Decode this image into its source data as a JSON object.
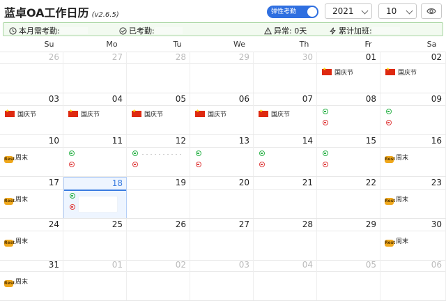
{
  "app": {
    "title": "蓝卓OA工作日历",
    "version": "(v2.6.5)"
  },
  "controls": {
    "flex_toggle_label": "弹性考勤",
    "year": "2021",
    "month": "10"
  },
  "summary": {
    "monthly_required": "本月需考勤:",
    "attended": "已考勤:",
    "abnormal": "异常: 0天",
    "overtime": "累计加班:"
  },
  "weekdays": [
    "Su",
    "Mo",
    "Tu",
    "We",
    "Th",
    "Fr",
    "Sa"
  ],
  "labels": {
    "holiday": "国庆节",
    "weekend": "周末",
    "weekend_icon_text": "Rest"
  },
  "weeks": [
    {
      "days": [
        {
          "n": "26",
          "m": "other"
        },
        {
          "n": "27",
          "m": "other"
        },
        {
          "n": "28",
          "m": "other"
        },
        {
          "n": "29",
          "m": "other"
        },
        {
          "n": "30",
          "m": "other"
        },
        {
          "n": "01",
          "m": "cur",
          "e": "holiday"
        },
        {
          "n": "02",
          "m": "cur",
          "e": "holiday"
        }
      ]
    },
    {
      "days": [
        {
          "n": "03",
          "m": "cur",
          "e": "holiday"
        },
        {
          "n": "04",
          "m": "cur",
          "e": "holiday"
        },
        {
          "n": "05",
          "m": "cur",
          "e": "holiday"
        },
        {
          "n": "06",
          "m": "cur",
          "e": "holiday"
        },
        {
          "n": "07",
          "m": "cur",
          "e": "holiday"
        },
        {
          "n": "08",
          "m": "cur",
          "e": "attend"
        },
        {
          "n": "09",
          "m": "cur",
          "e": "attend"
        }
      ]
    },
    {
      "days": [
        {
          "n": "10",
          "m": "cur",
          "e": "weekend"
        },
        {
          "n": "11",
          "m": "cur",
          "e": "attend"
        },
        {
          "n": "12",
          "m": "cur",
          "e": "attend"
        },
        {
          "n": "13",
          "m": "cur",
          "e": "attend"
        },
        {
          "n": "14",
          "m": "cur",
          "e": "attend"
        },
        {
          "n": "15",
          "m": "cur",
          "e": "attend"
        },
        {
          "n": "16",
          "m": "cur",
          "e": "weekend"
        }
      ]
    },
    {
      "days": [
        {
          "n": "17",
          "m": "cur",
          "e": "weekend"
        },
        {
          "n": "18",
          "m": "today",
          "e": "attend"
        },
        {
          "n": "19",
          "m": "cur"
        },
        {
          "n": "20",
          "m": "cur"
        },
        {
          "n": "21",
          "m": "cur"
        },
        {
          "n": "22",
          "m": "cur"
        },
        {
          "n": "23",
          "m": "cur",
          "e": "weekend"
        }
      ]
    },
    {
      "days": [
        {
          "n": "24",
          "m": "cur",
          "e": "weekend"
        },
        {
          "n": "25",
          "m": "cur"
        },
        {
          "n": "26",
          "m": "cur"
        },
        {
          "n": "27",
          "m": "cur"
        },
        {
          "n": "28",
          "m": "cur"
        },
        {
          "n": "29",
          "m": "cur"
        },
        {
          "n": "30",
          "m": "cur",
          "e": "weekend"
        }
      ]
    },
    {
      "days": [
        {
          "n": "31",
          "m": "cur",
          "e": "weekend"
        },
        {
          "n": "01",
          "m": "other"
        },
        {
          "n": "02",
          "m": "other"
        },
        {
          "n": "03",
          "m": "other"
        },
        {
          "n": "04",
          "m": "other"
        },
        {
          "n": "05",
          "m": "other"
        },
        {
          "n": "06",
          "m": "other"
        }
      ]
    }
  ]
}
